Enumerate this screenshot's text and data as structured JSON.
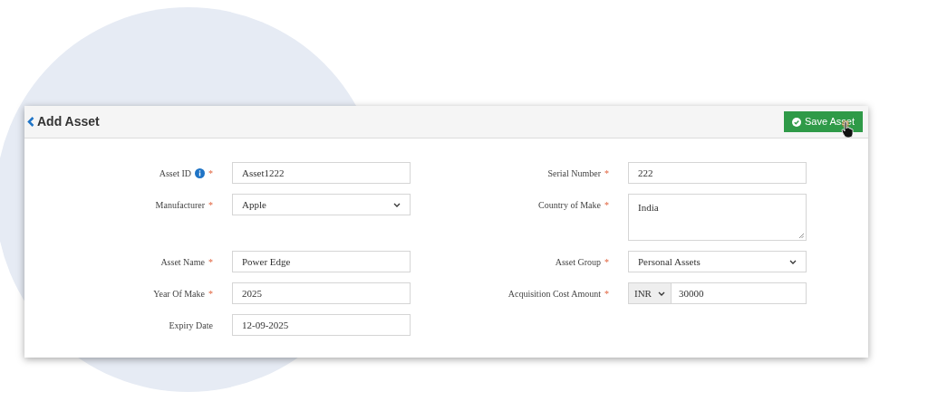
{
  "header": {
    "title": "Add Asset",
    "save_button": "Save Asset"
  },
  "rows": [
    {
      "fields": [
        {
          "label": "Asset ID",
          "required_mark": "*",
          "info": true,
          "kind": "text",
          "value": "Asset1222"
        },
        {
          "label": "Serial Number",
          "required_mark": "*",
          "kind": "text",
          "value": "222"
        }
      ]
    },
    {
      "fields": [
        {
          "label": "Manufacturer",
          "required_mark": "*",
          "kind": "select",
          "value": "Apple"
        },
        {
          "label": "Country of Make",
          "required_mark": "*",
          "kind": "textarea",
          "value": "India"
        }
      ]
    },
    {
      "fields": [
        {
          "label": "Asset Name",
          "required_mark": "*",
          "kind": "text",
          "value": "Power Edge"
        },
        {
          "label": "Asset Group",
          "required_mark": "*",
          "kind": "select",
          "value": "Personal Assets"
        }
      ]
    },
    {
      "fields": [
        {
          "label": "Year Of Make",
          "required_mark": "*",
          "kind": "text",
          "value": "2025"
        },
        {
          "label": "Acquisition Cost Amount",
          "required_mark": "*",
          "kind": "currency",
          "currency": "INR",
          "value": "30000"
        }
      ]
    },
    {
      "fields": [
        {
          "label": "Expiry Date",
          "kind": "text",
          "value": "12-09-2025"
        }
      ]
    }
  ]
}
